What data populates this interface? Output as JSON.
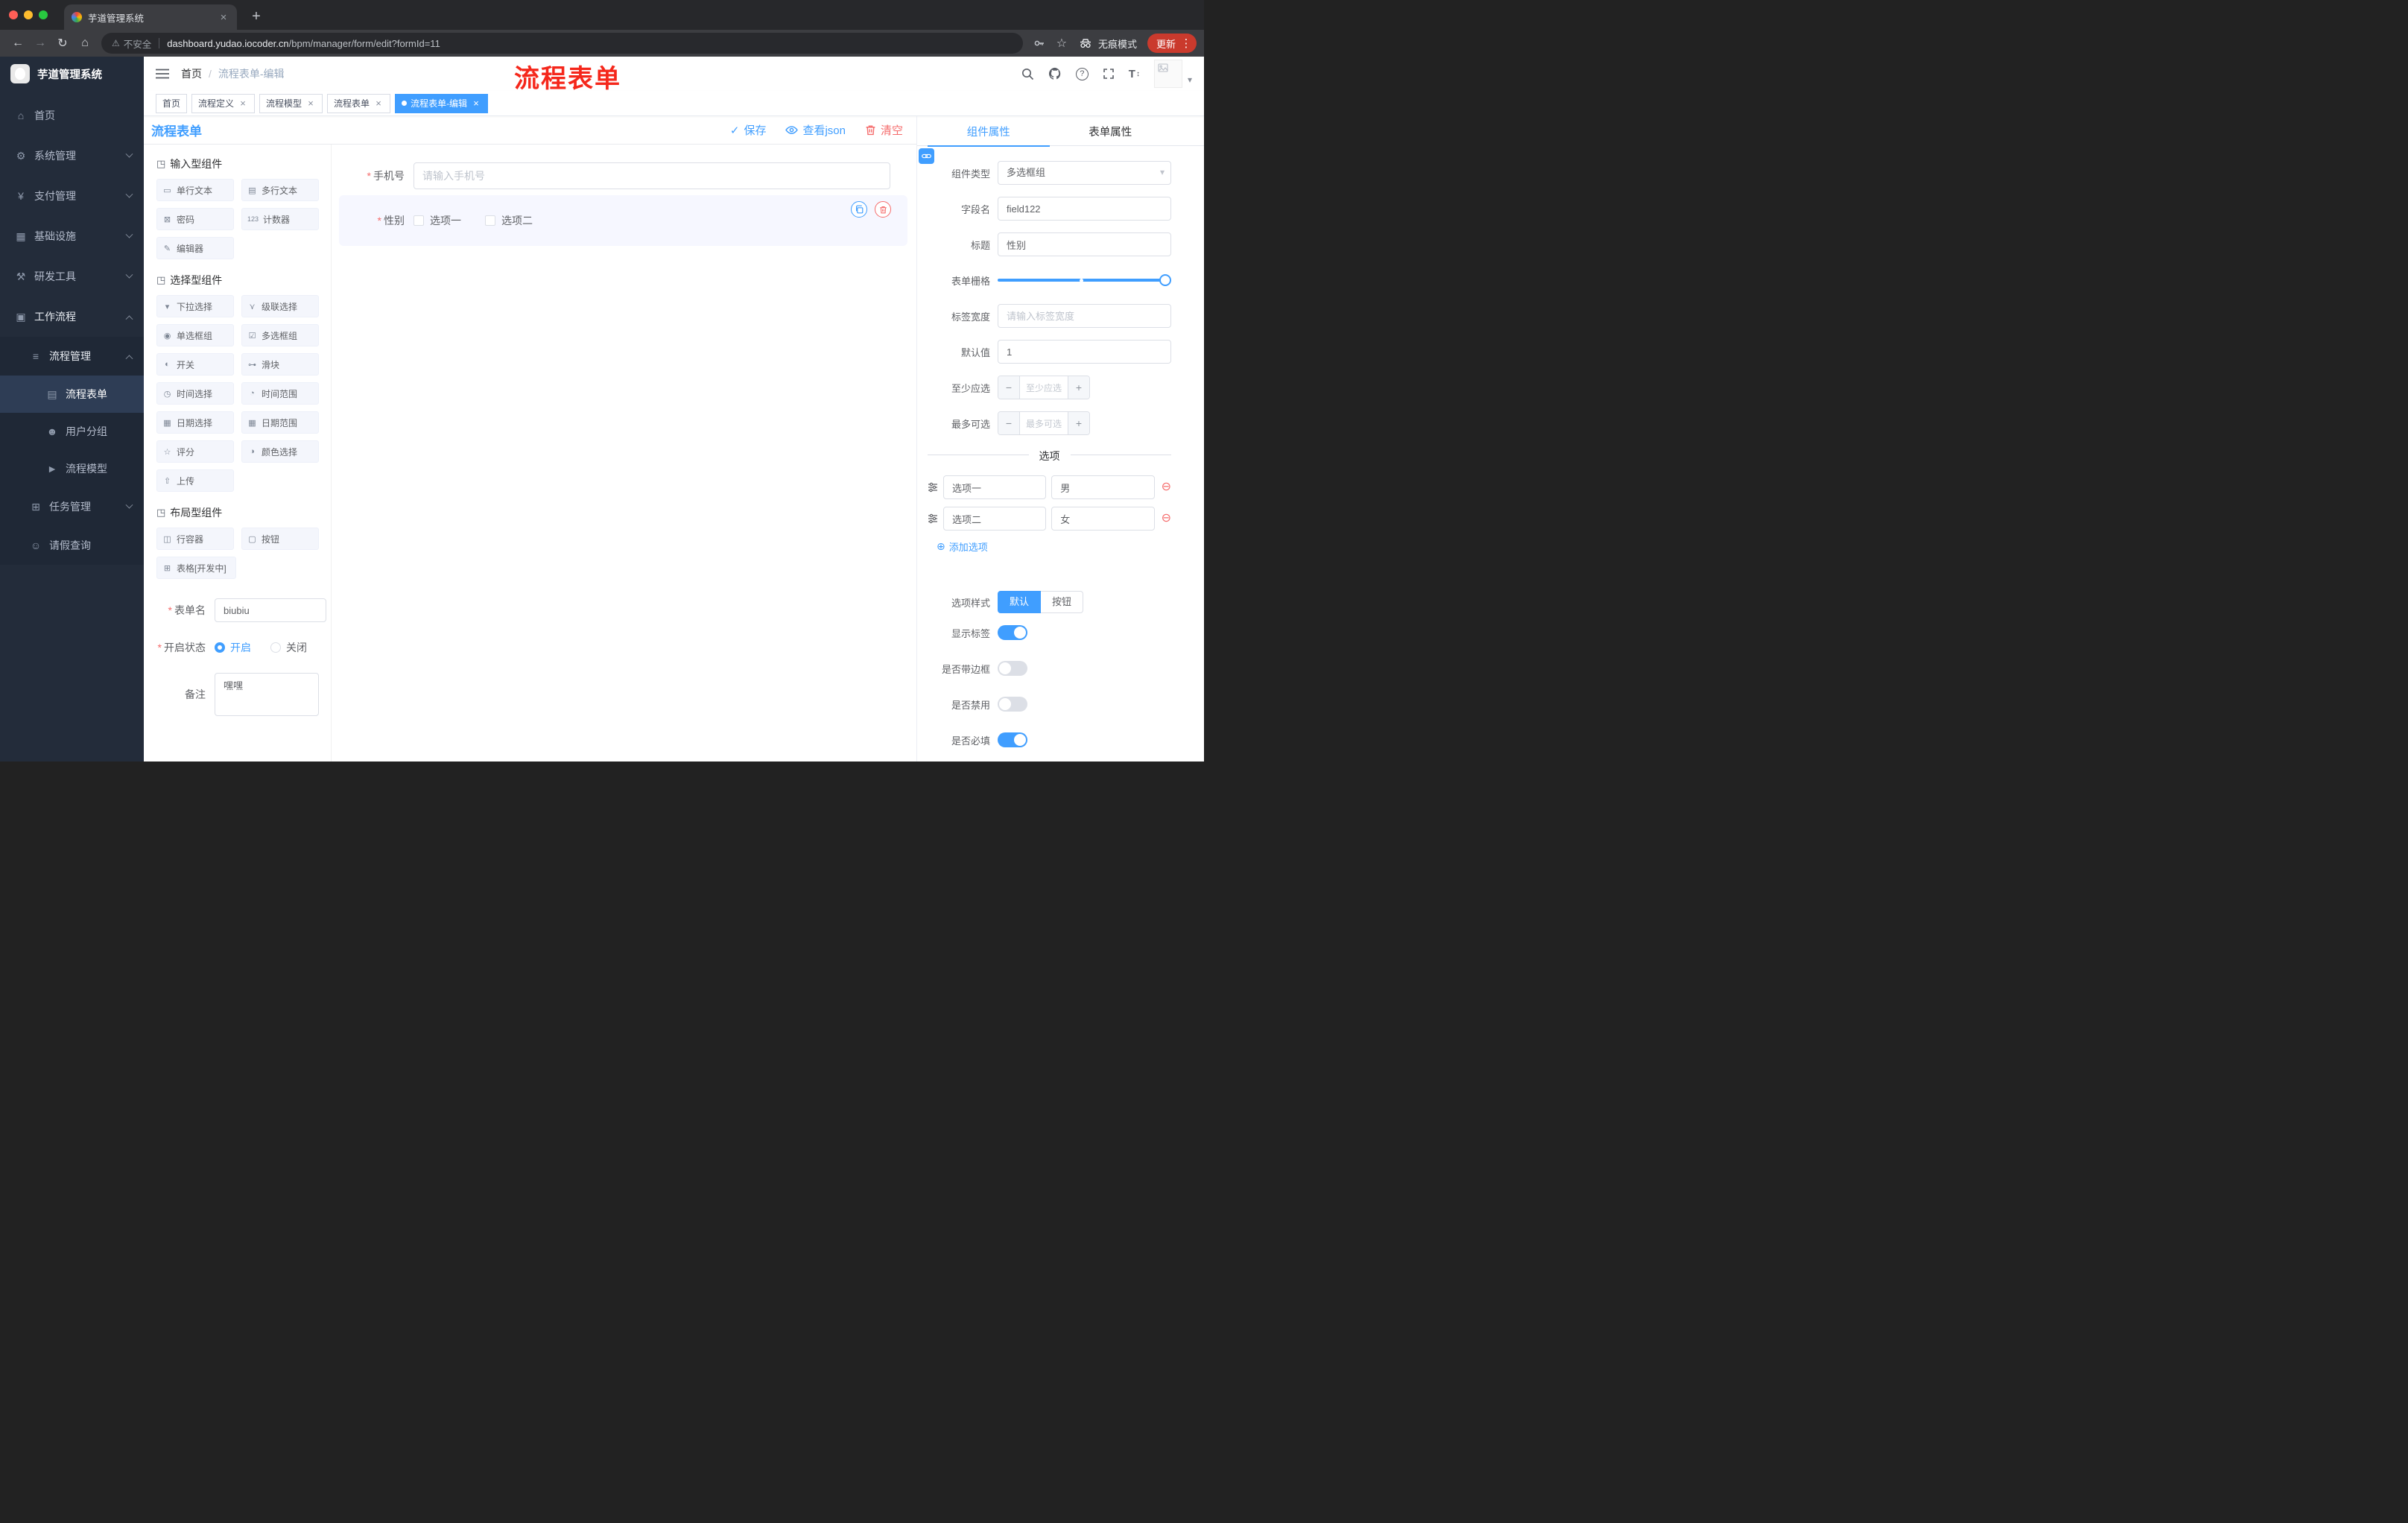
{
  "icons": {
    "close": "×",
    "new_tab": "+",
    "back": "←",
    "forward": "→",
    "reload": "↻",
    "home": "⌂",
    "warning": "⚠",
    "star": "☆",
    "kebab": "⋮",
    "caret": "▾",
    "question": "?",
    "font_t": "T",
    "font_updown": "↕",
    "check": "✓",
    "breadcrumb_sep": "/",
    "section_cube": "◳",
    "asterisk": "*",
    "minus": "−",
    "plus": "+",
    "add_circle": "⊕",
    "remove_circle": "⊖"
  },
  "browser": {
    "tab_title": "芋道管理系统",
    "address": {
      "warning_text": "不安全",
      "domain": "dashboard.yudao.iocoder.cn",
      "path": "/bpm/manager/form/edit?formId=11"
    },
    "incognito_label": "无痕模式",
    "update_label": "更新"
  },
  "sidebar": {
    "logo_title": "芋道管理系统",
    "menu": [
      {
        "label": "首页",
        "icon": "⌂"
      },
      {
        "label": "系统管理",
        "icon": "⚙"
      },
      {
        "label": "支付管理",
        "icon": "¥"
      },
      {
        "label": "基础设施",
        "icon": "▦"
      },
      {
        "label": "研发工具",
        "icon": "⚒"
      },
      {
        "label": "工作流程",
        "icon": "▣"
      },
      {
        "label": "流程管理",
        "icon": "≡"
      },
      {
        "label": "流程表单",
        "icon": "▤"
      },
      {
        "label": "用户分组",
        "icon": "☻"
      },
      {
        "label": "流程模型",
        "icon": "►"
      },
      {
        "label": "任务管理",
        "icon": "⊞"
      },
      {
        "label": "请假查询",
        "icon": "☺"
      }
    ]
  },
  "header": {
    "breadcrumb_home": "首页",
    "breadcrumb_current": "流程表单-编辑",
    "annotation": "流程表单"
  },
  "tags": [
    {
      "label": "首页"
    },
    {
      "label": "流程定义"
    },
    {
      "label": "流程模型"
    },
    {
      "label": "流程表单"
    },
    {
      "label": "流程表单-编辑"
    }
  ],
  "content": {
    "title": "流程表单",
    "actions": {
      "save": "保存",
      "view_json": "查看json",
      "clear": "清空"
    },
    "palette": {
      "sections": [
        {
          "title": "输入型组件",
          "items": [
            {
              "label": "单行文本",
              "icon": "▭"
            },
            {
              "label": "多行文本",
              "icon": "▤"
            },
            {
              "label": "密码",
              "icon": "⊠"
            },
            {
              "label": "计数器",
              "icon": "123"
            },
            {
              "label": "编辑器",
              "icon": "✎"
            }
          ]
        },
        {
          "title": "选择型组件",
          "items": [
            {
              "label": "下拉选择",
              "icon": "▾"
            },
            {
              "label": "级联选择",
              "icon": "⋎"
            },
            {
              "label": "单选框组",
              "icon": "◉"
            },
            {
              "label": "多选框组",
              "icon": "☑"
            },
            {
              "label": "开关",
              "icon": "◐"
            },
            {
              "label": "滑块",
              "icon": "⊶"
            },
            {
              "label": "时间选择",
              "icon": "◷"
            },
            {
              "label": "时间范围",
              "icon": "◔"
            },
            {
              "label": "日期选择",
              "icon": "▦"
            },
            {
              "label": "日期范围",
              "icon": "▦"
            },
            {
              "label": "评分",
              "icon": "☆"
            },
            {
              "label": "颜色选择",
              "icon": "◑"
            },
            {
              "label": "上传",
              "icon": "⇧"
            }
          ]
        },
        {
          "title": "布局型组件",
          "items": [
            {
              "label": "行容器",
              "icon": "◫"
            },
            {
              "label": "按钮",
              "icon": "▢"
            },
            {
              "label": "表格[开发中]",
              "icon": "⊞"
            }
          ]
        }
      ],
      "form": {
        "name_label": "表单名",
        "name_value": "biubiu",
        "status_label": "开启状态",
        "status_on": "开启",
        "status_off": "关闭",
        "remark_label": "备注",
        "remark_value": "嘿嘿"
      }
    },
    "canvas": {
      "phone_label": "手机号",
      "phone_placeholder": "请输入手机号",
      "gender_label": "性别",
      "gender_option1": "选项一",
      "gender_option2": "选项二"
    },
    "props": {
      "tab_component": "组件属性",
      "tab_form": "表单属性",
      "type_label": "组件类型",
      "type_value": "多选框组",
      "field_label": "字段名",
      "field_value": "field122",
      "title_label": "标题",
      "title_value": "性别",
      "grid_label": "表单栅格",
      "width_label": "标签宽度",
      "width_placeholder": "请输入标签宽度",
      "default_label": "默认值",
      "default_value": "1",
      "min_label": "至少应选",
      "min_placeholder": "至少应选",
      "max_label": "最多可选",
      "max_placeholder": "最多可选",
      "divider": "选项",
      "option1_label": "选项一",
      "option1_value": "男",
      "option2_label": "选项二",
      "option2_value": "女",
      "add_option": "添加选项",
      "style_label": "选项样式",
      "style_default": "默认",
      "style_button": "按钮",
      "show_label_label": "显示标签",
      "border_label": "是否带边框",
      "disabled_label": "是否禁用",
      "required_label": "是否必填"
    }
  },
  "colors": {
    "accent": "#409eff",
    "danger": "#f56c6c",
    "annotation": "#f5271b"
  }
}
